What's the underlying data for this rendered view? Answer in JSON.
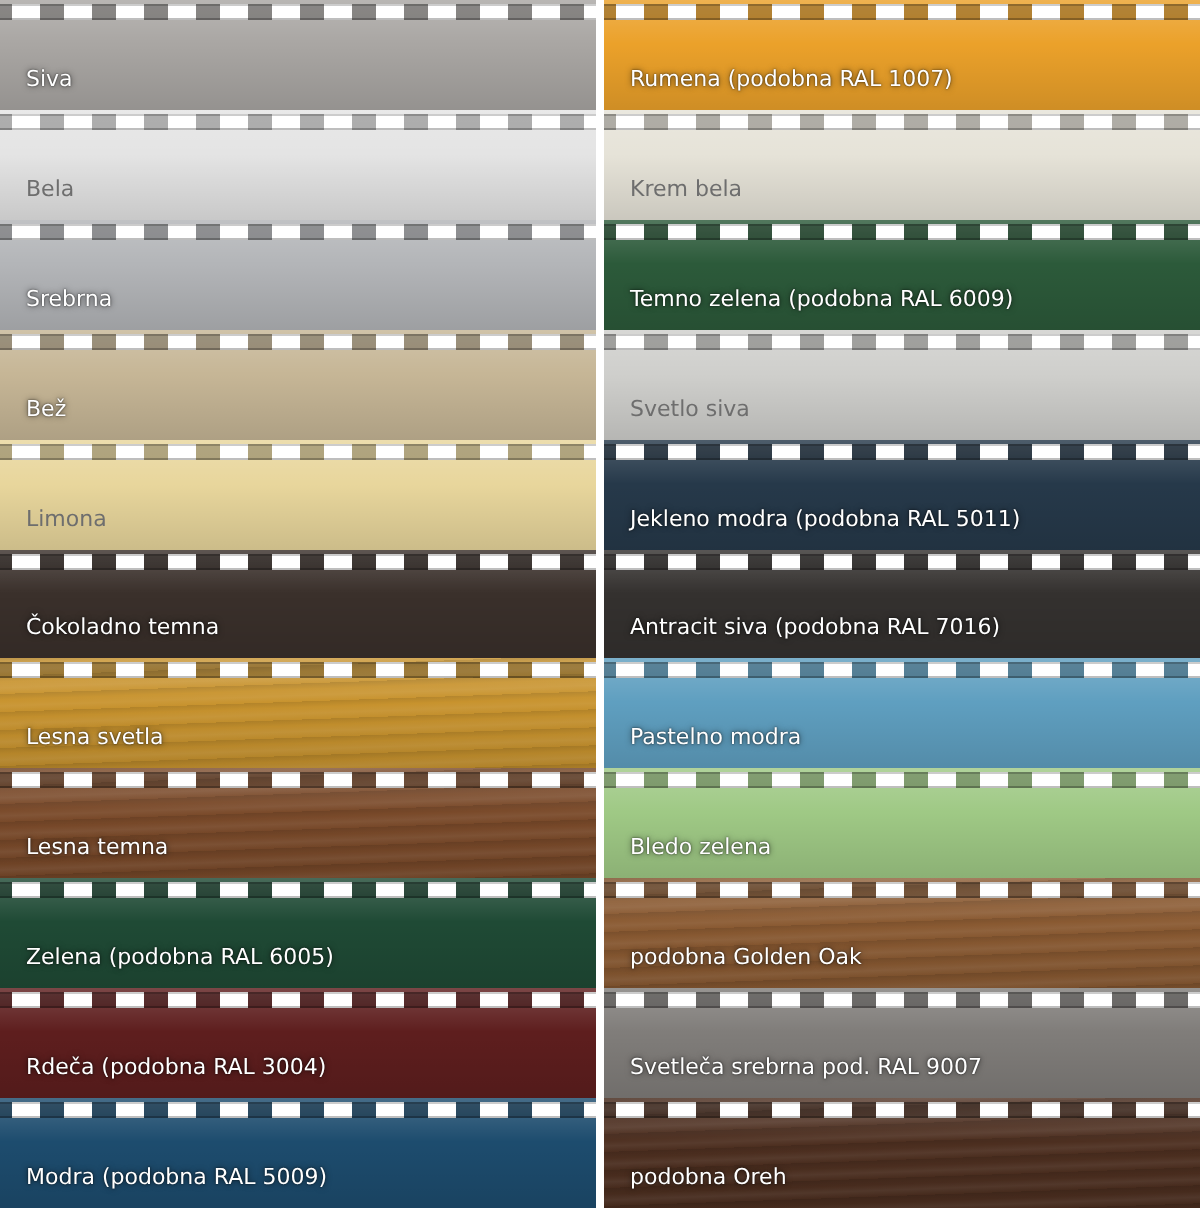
{
  "columns": [
    {
      "swatches": [
        {
          "label": "Siva",
          "color": "#a9a6a3",
          "kind": "plain"
        },
        {
          "label": "Bela",
          "color": "#e4e4e4",
          "kind": "plain"
        },
        {
          "label": "Srebrna",
          "color": "#b3b5b8",
          "kind": "plain"
        },
        {
          "label": "Bež",
          "color": "#c6b696",
          "kind": "plain"
        },
        {
          "label": "Limona",
          "color": "#e8d69c",
          "kind": "plain"
        },
        {
          "label": "Čokoladno temna",
          "color": "#3a302b",
          "kind": "plain"
        },
        {
          "label": "Lesna svetla",
          "color": "#c8932e",
          "kind": "wood"
        },
        {
          "label": "Lesna temna",
          "color": "#7a4a2a",
          "kind": "wood"
        },
        {
          "label": "Zelena (podobna RAL 6005)",
          "color": "#1f4a35",
          "kind": "plain"
        },
        {
          "label": "Rdeča (podobna RAL 3004)",
          "color": "#5e1e1e",
          "kind": "plain"
        },
        {
          "label": "Modra (podobna RAL 5009)",
          "color": "#1d4c6e",
          "kind": "plain"
        }
      ]
    },
    {
      "swatches": [
        {
          "label": "Rumena (podobna RAL 1007)",
          "color": "#eba12a",
          "kind": "plain"
        },
        {
          "label": "Krem bela",
          "color": "#e6e3d8",
          "kind": "plain"
        },
        {
          "label": "Temno zelena (podobna RAL 6009)",
          "color": "#2c5a3a",
          "kind": "plain"
        },
        {
          "label": "Svetlo siva",
          "color": "#cfcfcc",
          "kind": "plain"
        },
        {
          "label": "Jekleno modra (podobna RAL 5011)",
          "color": "#26394a",
          "kind": "plain"
        },
        {
          "label": "Antracit siva (podobna RAL 7016)",
          "color": "#34312f",
          "kind": "plain"
        },
        {
          "label": "Pastelno modra",
          "color": "#5f9fc0",
          "kind": "plain"
        },
        {
          "label": "Bledo zelena",
          "color": "#9fc985",
          "kind": "plain"
        },
        {
          "label": "podobna Golden Oak",
          "color": "#8a5a32",
          "kind": "wood"
        },
        {
          "label": "Svetleča srebrna pod. RAL 9007",
          "color": "#807d7a",
          "kind": "plain"
        },
        {
          "label": "podobna Oreh",
          "color": "#4d2f20",
          "kind": "wood"
        }
      ]
    }
  ]
}
